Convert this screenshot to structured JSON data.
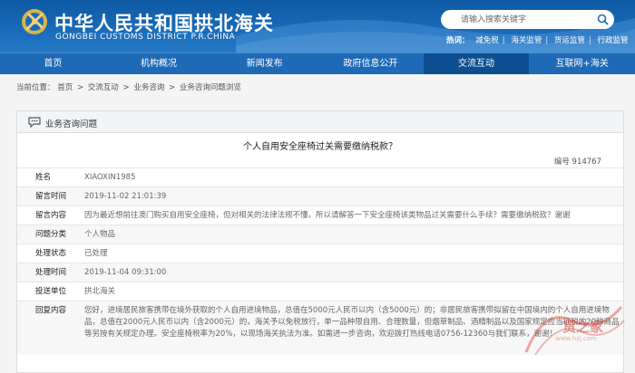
{
  "header": {
    "site_title": "中华人民共和国拱北海关",
    "site_subtitle": "GONGBEI CUSTOMS DISTRICT P.R.CHINA",
    "search_placeholder": "请输入搜索关键字",
    "hot_label": "热词：",
    "hot_words": [
      "减免税",
      "海关监管",
      "货运监管",
      "行政监管"
    ]
  },
  "nav": {
    "items": [
      "首页",
      "机构概况",
      "新闻发布",
      "政府信息公开",
      "交流互动",
      "互联网+海关"
    ],
    "active_index": 4
  },
  "breadcrumb": {
    "prefix": "当前位置：",
    "items": [
      "首页",
      "交流互动",
      "业务咨询",
      "业务咨询问题浏览"
    ],
    "separator": ">"
  },
  "panel": {
    "title": "业务咨询问题",
    "question_title": "个人自用安全座椅过关需要缴纳税款？",
    "number_label": "编号",
    "number": "914767",
    "rows": [
      {
        "key": "姓名",
        "value": "XIAOXIN1985"
      },
      {
        "key": "留言时间",
        "value": "2019-11-02 21:01:39"
      },
      {
        "key": "留言内容",
        "value": "因为最近想前往澳门购买自用安全座椅，但对相关的法律法规不懂，所以请解答一下安全座椅该类物品过关需要什么手续？需要缴纳税款？谢谢"
      },
      {
        "key": "问题分类",
        "value": "个人物品"
      },
      {
        "key": "处理状态",
        "value": "已处理"
      },
      {
        "key": "处理时间",
        "value": "2019-11-04 09:31:00"
      },
      {
        "key": "投送单位",
        "value": "拱北海关"
      },
      {
        "key": "回复内容",
        "value": "您好，进境居民旅客携带在境外获取的个人自用进境物品，总值在5000元人民币以内（含5000元）的；非居民旅客携带拟留在中国境内的个人自用进境物品，总值在2000元人民币以内（含2000元）的，海关予以免税放行，单一品种限自用、合理数量，但烟草制品、酒精制品以及国家规定应当征税的20种商品等另按有关规定办理。安全座椅税率为20%，以现场海关执法为准。如需进一步咨询，欢迎拨打热线电话0756-12360与我们联系，谢谢！"
      }
    ]
  },
  "watermark": {
    "text": "货之家",
    "url": "www.hzj.com"
  },
  "colors": {
    "header_blue": "#1a6cba",
    "nav_blue": "#1f6ab6",
    "nav_active": "#0d4f91"
  }
}
